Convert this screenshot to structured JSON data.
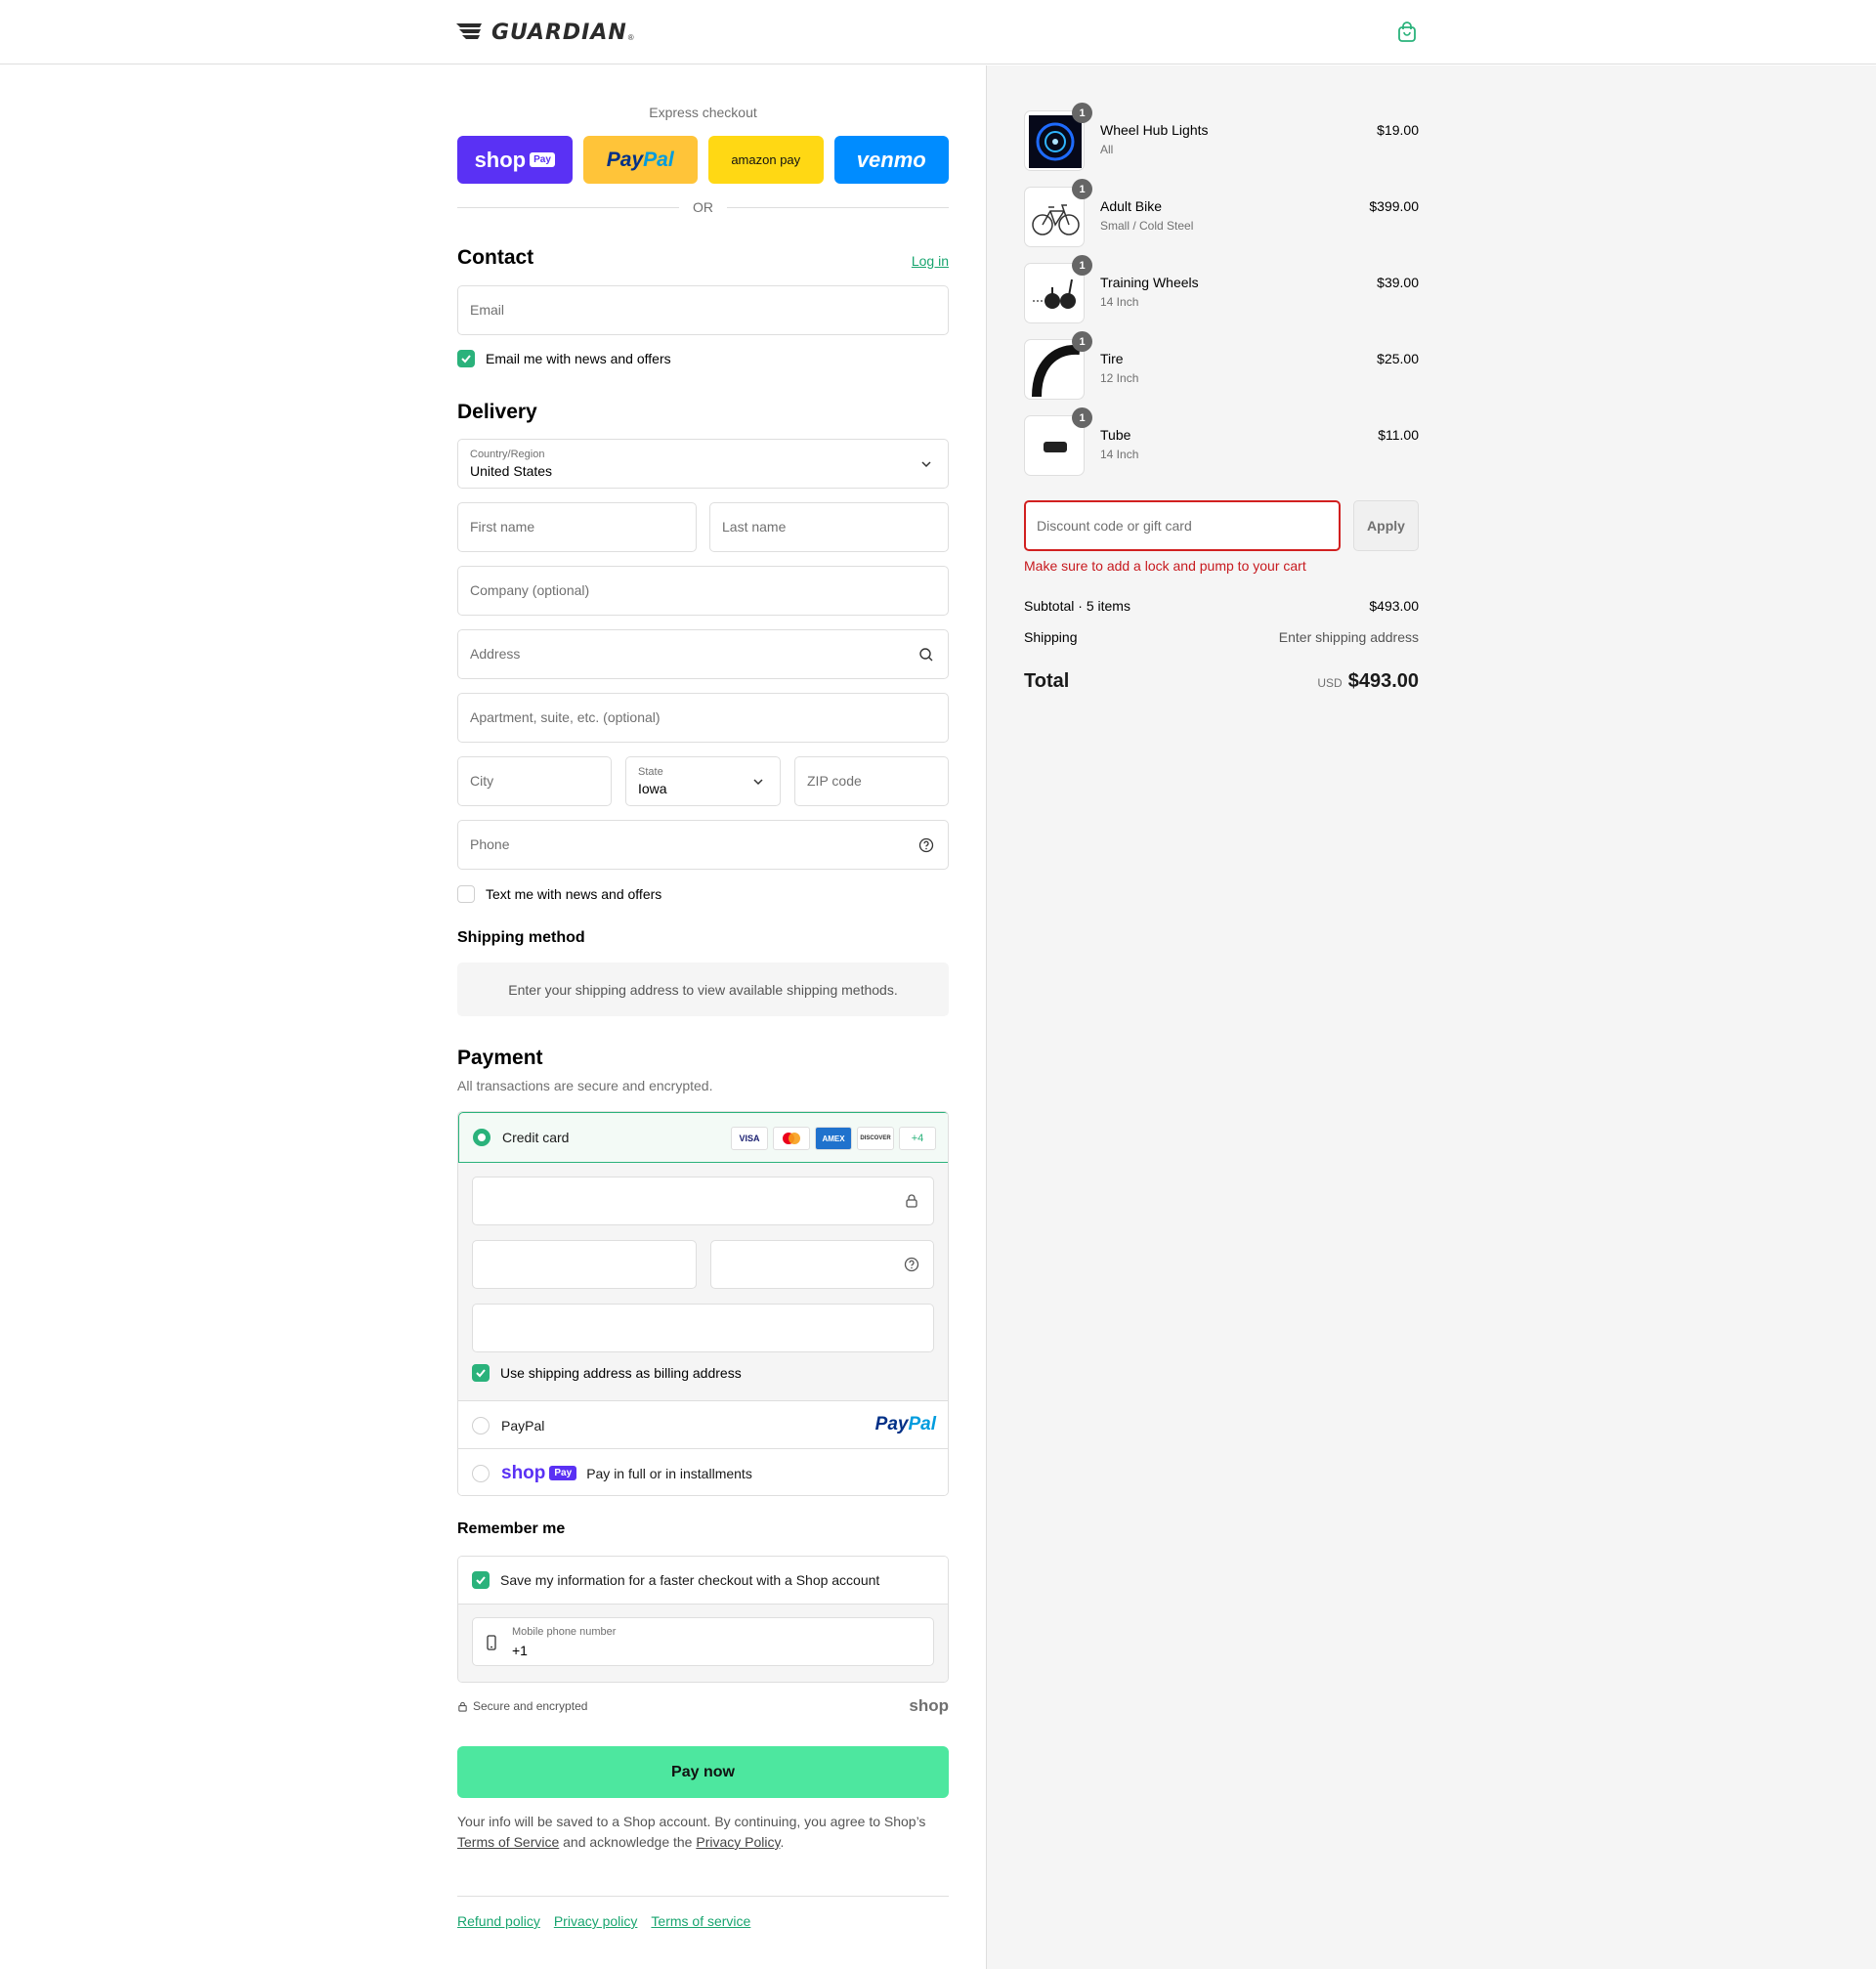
{
  "brand": {
    "name": "GUARDIAN",
    "reg": "®"
  },
  "express": {
    "title": "Express checkout",
    "shop_pay": "shop",
    "shop_pay_chip": "Pay",
    "paypal_a": "Pay",
    "paypal_b": "Pal",
    "amazon_pay": "amazon pay",
    "venmo": "venmo",
    "or": "OR"
  },
  "contact": {
    "title": "Contact",
    "login": "Log in",
    "email_placeholder": "Email",
    "news_label": "Email me with news and offers",
    "news_checked": true
  },
  "delivery": {
    "title": "Delivery",
    "country_label": "Country/Region",
    "country_value": "United States",
    "first_name": "First name",
    "last_name": "Last name",
    "company": "Company (optional)",
    "address": "Address",
    "apartment": "Apartment, suite, etc. (optional)",
    "city": "City",
    "state_label": "State",
    "state_value": "Iowa",
    "zip": "ZIP code",
    "phone": "Phone",
    "text_label": "Text me with news and offers",
    "text_checked": false
  },
  "shipping_method": {
    "title": "Shipping method",
    "info": "Enter your shipping address to view available shipping methods."
  },
  "payment": {
    "title": "Payment",
    "subtitle": "All transactions are secure and encrypted.",
    "credit_card": "Credit card",
    "brands": [
      "VISA",
      "MC",
      "AMEX",
      "DISCOVER",
      "+4"
    ],
    "billing_label": "Use shipping address as billing address",
    "paypal_label": "PayPal",
    "paypal_logo_a": "Pay",
    "paypal_logo_b": "Pal",
    "shop_pay_word": "shop",
    "shop_pay_chip": "Pay",
    "shop_pay_label": "Pay in full or in installments"
  },
  "remember": {
    "title": "Remember me",
    "save_label": "Save my information for a faster checkout with a Shop account",
    "phone_label": "Mobile phone number",
    "phone_value": "+1"
  },
  "secure": {
    "text": "Secure and encrypted",
    "shop": "shop"
  },
  "pay_now": "Pay now",
  "legal": {
    "t1": "Your info will be saved to a Shop account. By continuing, you agree to Shop’s",
    "tos": "Terms of Service",
    "t2": " and acknowledge the ",
    "privacy": "Privacy Policy",
    "t3": "."
  },
  "footer": {
    "refund": "Refund policy",
    "privacy": "Privacy policy",
    "terms": "Terms of service"
  },
  "cart": {
    "items": [
      {
        "name": "Wheel Hub Lights",
        "variant": "All",
        "price": "$19.00",
        "qty": "1",
        "thumb": "wheel-light"
      },
      {
        "name": "Adult Bike",
        "variant": "Small / Cold Steel",
        "price": "$399.00",
        "qty": "1",
        "thumb": "bike"
      },
      {
        "name": "Training Wheels",
        "variant": "14 Inch",
        "price": "$39.00",
        "qty": "1",
        "thumb": "training-wheels"
      },
      {
        "name": "Tire",
        "variant": "12 Inch",
        "price": "$25.00",
        "qty": "1",
        "thumb": "tire"
      },
      {
        "name": "Tube",
        "variant": "14 Inch",
        "price": "$11.00",
        "qty": "1",
        "thumb": "tube"
      }
    ],
    "discount_placeholder": "Discount code or gift card",
    "apply": "Apply",
    "discount_error": "Make sure to add a lock and pump to your cart",
    "subtotal_label": "Subtotal · 5 items",
    "subtotal_value": "$493.00",
    "shipping_label": "Shipping",
    "shipping_value": "Enter shipping address",
    "total_label": "Total",
    "currency": "USD",
    "total_value": "$493.00"
  },
  "colors": {
    "accent": "#2ab27b",
    "pay_now": "#4de79f",
    "error": "#c7191e",
    "shop_purple": "#5a31f4"
  }
}
